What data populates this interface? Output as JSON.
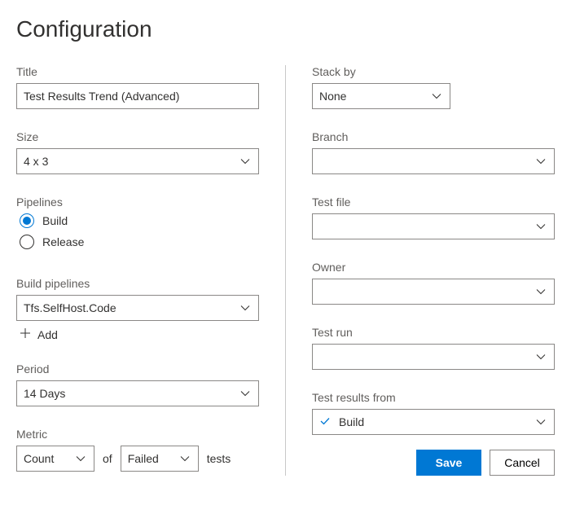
{
  "header": {
    "title": "Configuration"
  },
  "left": {
    "title_label": "Title",
    "title_value": "Test Results Trend (Advanced)",
    "size_label": "Size",
    "size_value": "4 x 3",
    "pipelines_label": "Pipelines",
    "radio_build": "Build",
    "radio_release": "Release",
    "build_pipelines_label": "Build pipelines",
    "build_pipelines_value": "Tfs.SelfHost.Code",
    "add_label": "Add",
    "period_label": "Period",
    "period_value": "14 Days",
    "metric_label": "Metric",
    "metric_count": "Count",
    "metric_of": "of",
    "metric_failed": "Failed",
    "metric_tests": "tests"
  },
  "right": {
    "stack_by_label": "Stack by",
    "stack_by_value": "None",
    "branch_label": "Branch",
    "branch_value": "",
    "testfile_label": "Test file",
    "testfile_value": "",
    "owner_label": "Owner",
    "owner_value": "",
    "testrun_label": "Test run",
    "testrun_value": "",
    "results_from_label": "Test results from",
    "results_from_value": "Build",
    "save_label": "Save",
    "cancel_label": "Cancel"
  }
}
